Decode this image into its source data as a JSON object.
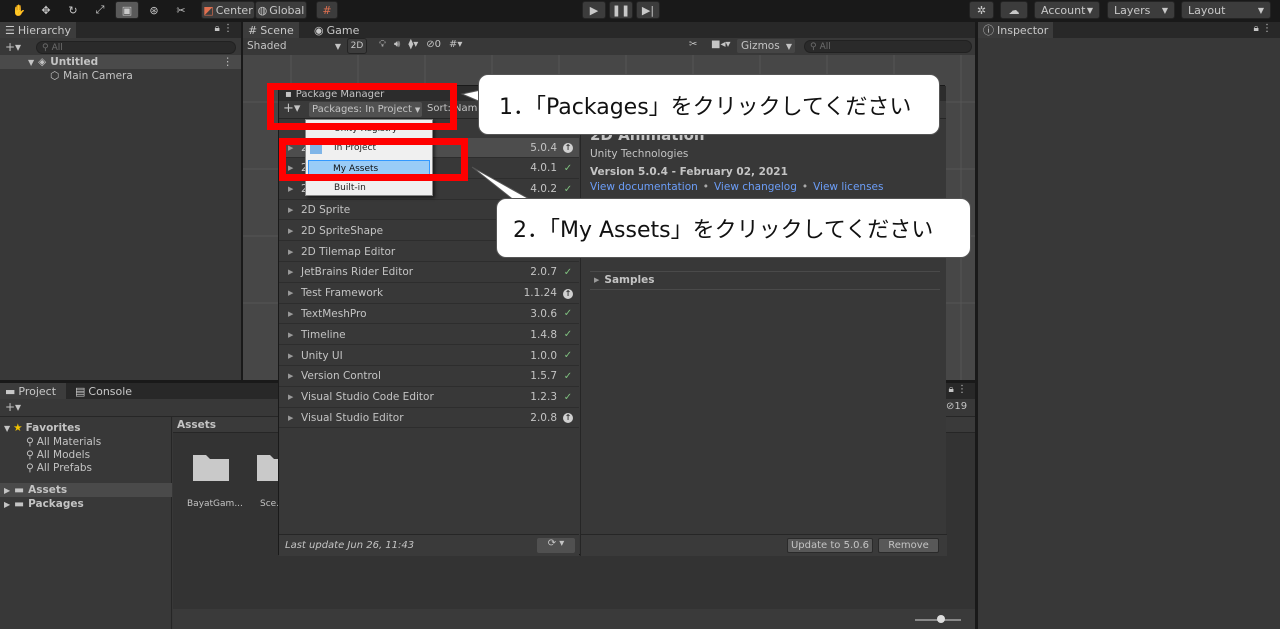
{
  "toolbar": {
    "center": "Center",
    "global": "Global",
    "account": "Account",
    "layers": "Layers",
    "layout": "Layout"
  },
  "hierarchy": {
    "tab": "Hierarchy",
    "search_placeholder": "All",
    "scene": "Untitled",
    "items": [
      "Main Camera"
    ]
  },
  "scene_tabs": {
    "scene": "Scene",
    "game": "Game",
    "shaded": "Shaded",
    "mode_2d": "2D",
    "hidden_count": "0",
    "gizmos": "Gizmos",
    "search_placeholder": "All"
  },
  "inspector": {
    "tab": "Inspector"
  },
  "project": {
    "tab_project": "Project",
    "tab_console": "Console",
    "hidden_count": "19",
    "favorites": "Favorites",
    "fav_items": [
      "All Materials",
      "All Models",
      "All Prefabs"
    ],
    "roots": [
      "Assets",
      "Packages"
    ],
    "breadcrumb": "Assets",
    "files": [
      "BayatGam...",
      "Sce..."
    ]
  },
  "package_manager": {
    "title": "Package Manager",
    "packages_filter": "Packages: In Project",
    "sort": "Sort: Name",
    "dropdown": {
      "items": [
        "Unity Registry",
        "In Project",
        "My Assets",
        "Built-in"
      ],
      "highlighted": "My Assets"
    },
    "list": [
      {
        "name": "2D Animation",
        "version": "5.0.4",
        "status": "update",
        "sel": true
      },
      {
        "name": "2D Common",
        "version": "4.0.1",
        "status": "ok"
      },
      {
        "name": "2D PSD Importer",
        "version": "4.0.2",
        "status": "ok"
      },
      {
        "name": "2D Sprite",
        "version": "",
        "status": ""
      },
      {
        "name": "2D SpriteShape",
        "version": "",
        "status": ""
      },
      {
        "name": "2D Tilemap Editor",
        "version": "",
        "status": ""
      },
      {
        "name": "JetBrains Rider Editor",
        "version": "2.0.7",
        "status": "ok"
      },
      {
        "name": "Test Framework",
        "version": "1.1.24",
        "status": "update"
      },
      {
        "name": "TextMeshPro",
        "version": "3.0.6",
        "status": "ok"
      },
      {
        "name": "Timeline",
        "version": "1.4.8",
        "status": "ok"
      },
      {
        "name": "Unity UI",
        "version": "1.0.0",
        "status": "ok"
      },
      {
        "name": "Version Control",
        "version": "1.5.7",
        "status": "ok"
      },
      {
        "name": "Visual Studio Code Editor",
        "version": "1.2.3",
        "status": "ok"
      },
      {
        "name": "Visual Studio Editor",
        "version": "2.0.8",
        "status": "update"
      }
    ],
    "last_update": "Last update Jun 26, 11:43",
    "details": {
      "title": "2D Animation",
      "publisher": "Unity Technologies",
      "version_line": "Version 5.0.4 - February 02, 2021",
      "links": [
        "View documentation",
        "View changelog",
        "View licenses"
      ],
      "samples": "Samples"
    },
    "update_button": "Update to 5.0.6",
    "remove_button": "Remove"
  },
  "annotations": {
    "step1": "1．「Packages」をクリックしてください",
    "step2": "2．「My Assets」をクリックしてください"
  },
  "colors": {
    "highlight_red": "#ff0000",
    "dropdown_highlight": "#99ccf7",
    "link": "#6c9ef8"
  }
}
